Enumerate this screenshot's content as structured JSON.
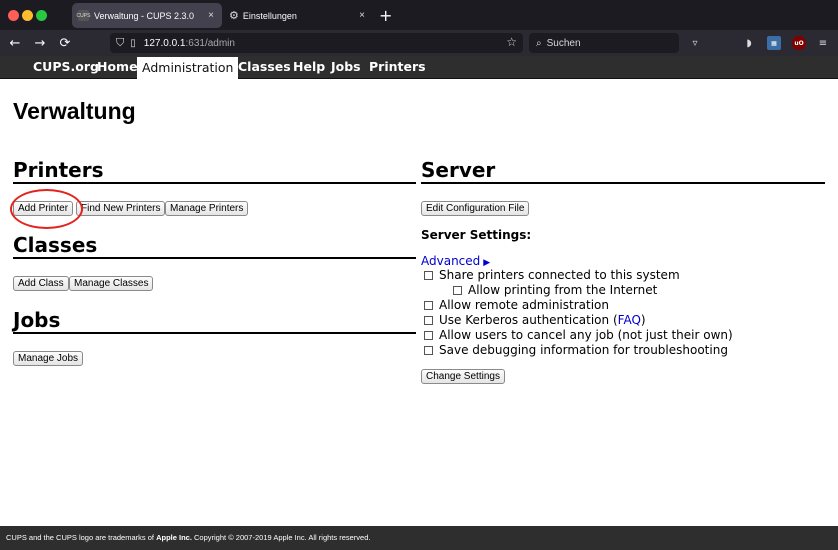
{
  "browser": {
    "tabs": [
      {
        "title": "Verwaltung - CUPS 2.3.0",
        "favicon_text": "CUPS",
        "close": "×"
      },
      {
        "title": "Einstellungen",
        "close": "×"
      }
    ],
    "new_tab": "+",
    "nav": {
      "back": "←",
      "forward": "→",
      "reload": "⟳"
    },
    "url_host": "127.0.0.1",
    "url_path": ":631/admin",
    "search_placeholder": "Suchen",
    "extension_ublock": "uO"
  },
  "menu": {
    "items": [
      "CUPS.org",
      "Home",
      "Administration",
      "Classes",
      "Help",
      "Jobs",
      "Printers"
    ],
    "active": "Administration"
  },
  "page": {
    "title": "Verwaltung",
    "printers": {
      "heading": "Printers",
      "buttons": [
        "Add Printer",
        "Find New Printers",
        "Manage Printers"
      ]
    },
    "classes": {
      "heading": "Classes",
      "buttons": [
        "Add Class",
        "Manage Classes"
      ]
    },
    "jobs": {
      "heading": "Jobs",
      "buttons": [
        "Manage Jobs"
      ]
    },
    "server": {
      "heading": "Server",
      "edit_button": "Edit Configuration File",
      "settings_label": "Server Settings:",
      "advanced": "Advanced",
      "advanced_arrow": "▶",
      "options": [
        "Share printers connected to this system",
        "Allow printing from the Internet",
        "Allow remote administration",
        "Use Kerberos authentication (",
        "Allow users to cancel any job (not just their own)",
        "Save debugging information for troubleshooting"
      ],
      "faq_link": "FAQ",
      "faq_close": ")",
      "change_button": "Change Settings"
    }
  },
  "footer": {
    "pre": "CUPS and the CUPS logo are trademarks of ",
    "company": "Apple Inc.",
    "post": " Copyright © 2007-2019 Apple Inc. All rights reserved."
  },
  "colors": {
    "annotation": "#e3231d",
    "link": "#0000cc",
    "menu_bg": "#2e2e2e"
  }
}
